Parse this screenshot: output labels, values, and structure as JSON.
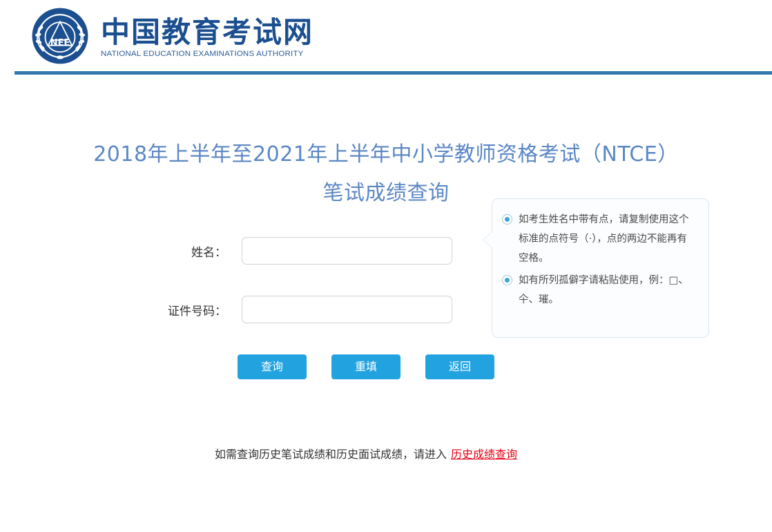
{
  "header": {
    "logo_icon": "nee-emblem-icon",
    "wordmark_cn": "中国教育考试网",
    "wordmark_en": "NATIONAL EDUCATION EXAMINATIONS AUTHORITY",
    "rule_color": "#3178ad"
  },
  "page": {
    "title_line1": "2018年上半年至2021年上半年中小学教师资格考试（NTCE）",
    "title_line2": "笔试成绩查询",
    "title_color": "#5b87c5"
  },
  "form": {
    "name_label": "姓名：",
    "name_value": "",
    "name_placeholder": "",
    "id_label": "证件号码：",
    "id_value": "",
    "id_placeholder": ""
  },
  "notes": {
    "items": [
      "如考生姓名中带有点，请复制使用这个标准的点符号（·），点的两边不能再有空格。",
      "如有所列孤僻字请粘贴使用，例：□、仐、璀。"
    ],
    "bullet_color": "#3aa5d6"
  },
  "buttons": {
    "query": "查询",
    "reset": "重填",
    "back": "返回",
    "color": "#22a3e0"
  },
  "footer": {
    "text": "如需查询历史笔试成绩和历史面试成绩，请进入",
    "link_text": "历史成绩查询",
    "link_color": "#e60012"
  }
}
